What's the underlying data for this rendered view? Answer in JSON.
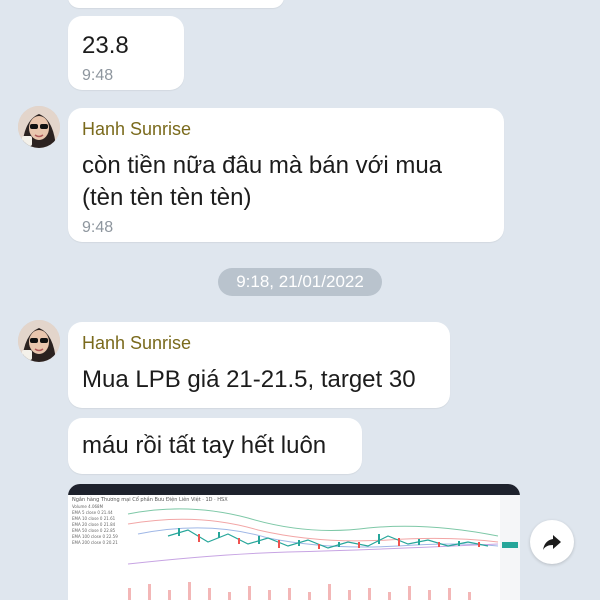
{
  "conversation": {
    "messages": [
      {
        "text": "23.8",
        "time": "9:48"
      },
      {
        "sender": "Hanh Sunrise",
        "text_lines": [
          "còn tiền nữa đâu mà bán với mua",
          "(tèn tèn tèn tèn)"
        ],
        "time": "9:48"
      }
    ],
    "date_separator": "9:18, 21/01/2022",
    "group": {
      "sender": "Hanh Sunrise",
      "messages": [
        {
          "text": "Mua LPB giá 21-21.5, target 30"
        },
        {
          "text": "máu rồi tất tay hết luôn"
        }
      ],
      "image": {
        "alt": "stock chart screenshot",
        "chart_title": "Ngân hàng Thương mại Cổ phần Bưu Điện Liên Việt · 1D · HSX",
        "indicators": [
          "Volume 4.068M",
          "EMA 5 close 0 21.44",
          "EMA 10 close 0 21.61",
          "EMA 20 close 0 21.84",
          "EMA 50 close 0 22.85",
          "EMA 100 close 0 22.59",
          "EMA 200 close 0 20.21"
        ]
      }
    }
  },
  "icons": {
    "share": "share-arrow-icon",
    "avatar": "user-avatar"
  },
  "colors": {
    "background": "#dfe6ee",
    "bubble": "#ffffff",
    "sender": "#7a6a1c",
    "time": "#8e969e",
    "date_pill": "#b9c3cd"
  }
}
